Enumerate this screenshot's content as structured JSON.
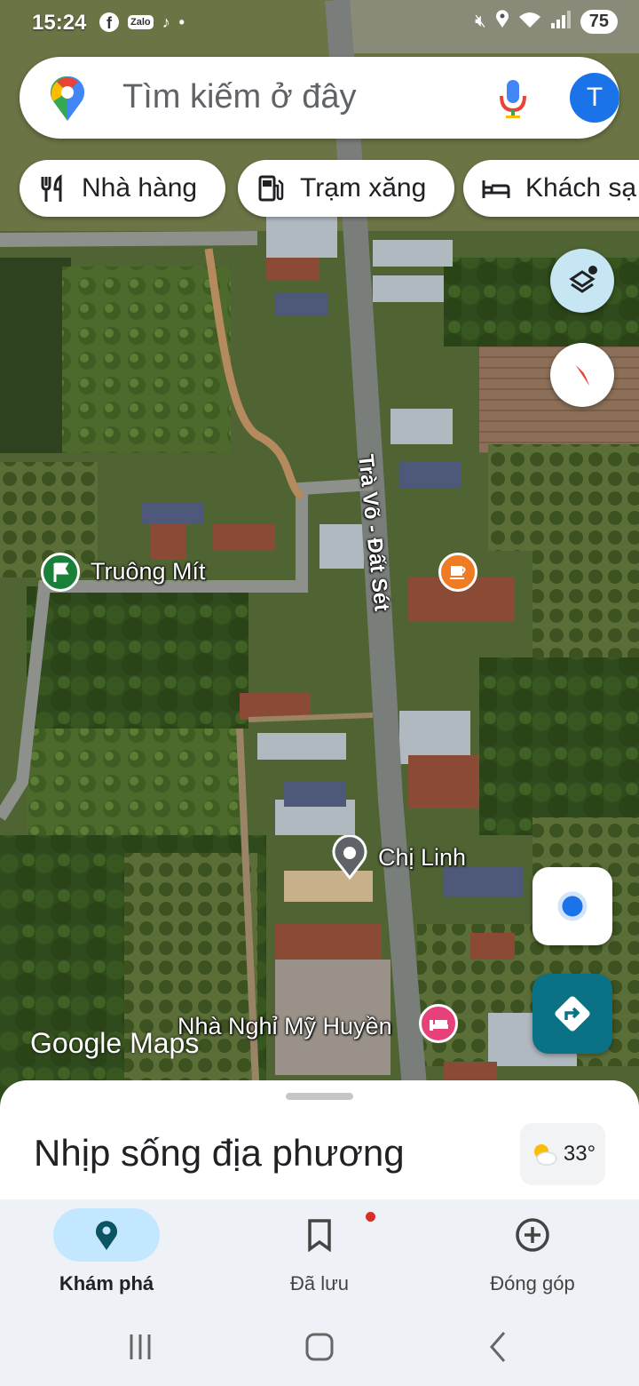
{
  "status_bar": {
    "time": "15:24",
    "apps": [
      "facebook-icon",
      "zalo-icon",
      "tiktok-icon"
    ],
    "zalo_text": "Zalo",
    "battery": "75"
  },
  "search": {
    "placeholder": "Tìm kiếm ở đây",
    "avatar_letter": "T"
  },
  "chips": [
    {
      "label": "Nhà hàng",
      "icon": "restaurant-icon"
    },
    {
      "label": "Trạm xăng",
      "icon": "gas-station-icon"
    },
    {
      "label": "Khách sạ",
      "icon": "hotel-icon"
    }
  ],
  "map": {
    "road_label": "Trà Võ - Đất Sét",
    "places": [
      {
        "name": "Truông Mít",
        "icon": "flag-icon",
        "color": "#188038"
      },
      {
        "name": "Chị Linh",
        "icon": "place-icon",
        "color": "#5f6368"
      },
      {
        "name": "Nhà Nghỉ Mỹ Huyền",
        "icon": "bed-icon",
        "color": "#e8407a"
      }
    ],
    "cafe_icon_color": "#ef7b25",
    "watermark": "Google Maps"
  },
  "sheet": {
    "title": "Nhịp sống địa phương",
    "temperature": "33°"
  },
  "bottom_nav": {
    "items": [
      {
        "label": "Khám phá",
        "icon": "explore-pin-icon",
        "active": true
      },
      {
        "label": "Đã lưu",
        "icon": "bookmark-icon",
        "active": false
      },
      {
        "label": "Đóng góp",
        "icon": "add-circle-icon",
        "active": false
      }
    ]
  },
  "colors": {
    "accent": "#1a73e8",
    "directions": "#0b7285",
    "nav_active_bg": "#c2e7ff"
  }
}
